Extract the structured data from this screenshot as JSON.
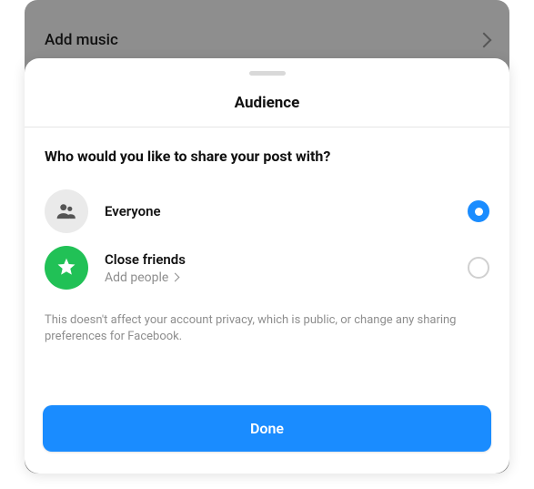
{
  "background": {
    "row_label": "Add music"
  },
  "sheet": {
    "title": "Audience",
    "heading": "Who would you like to share your post with?",
    "options": [
      {
        "title": "Everyone",
        "subtitle": null,
        "selected": true
      },
      {
        "title": "Close friends",
        "subtitle": "Add people",
        "selected": false
      }
    ],
    "disclaimer": "This doesn't affect your account privacy, which is public, or change any sharing preferences for Facebook.",
    "done_label": "Done"
  },
  "colors": {
    "accent_blue": "#1a8cff",
    "accent_green": "#21c156"
  }
}
